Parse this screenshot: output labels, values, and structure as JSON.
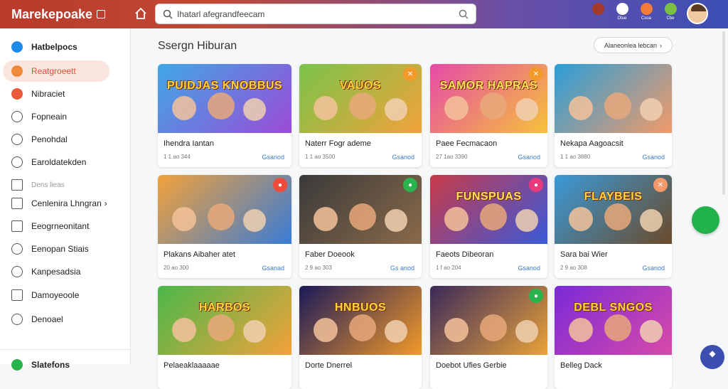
{
  "app": {
    "logo": "Marekepoake"
  },
  "search": {
    "value": "Ihatarl afegrandfeecam"
  },
  "topbar_icons": [
    {
      "name": "profile-badge-icon",
      "label": "",
      "color": "#a33a2a"
    },
    {
      "name": "calendar-icon",
      "label": "Otue",
      "color": "#ffffff"
    },
    {
      "name": "game-icon",
      "label": "Csoa",
      "color": "#f47a3a"
    },
    {
      "name": "chat-icon",
      "label": "Cbe",
      "color": "#7bc043"
    }
  ],
  "sidebar": {
    "items": [
      {
        "label": "Hatbelpocs",
        "icon": "compass-icon",
        "icon_color": "#1e8be6",
        "style": "bold"
      },
      {
        "label": "Reatgroeett",
        "icon": "fire-icon",
        "icon_color": "#f08a3a",
        "style": "active"
      },
      {
        "label": "Nibraciet",
        "icon": "star-icon",
        "icon_color": "#e85a3a",
        "style": ""
      },
      {
        "label": "Fopneain",
        "icon": "clock-icon",
        "icon_color": "",
        "style": "outline"
      },
      {
        "label": "Penohdal",
        "icon": "history-icon",
        "icon_color": "",
        "style": "outline"
      },
      {
        "label": "Earoldatekden",
        "icon": "bookmark-icon",
        "icon_color": "",
        "style": "outline"
      },
      {
        "label": "Dens lieas",
        "icon": "minus-icon",
        "icon_color": "",
        "style": "muted"
      },
      {
        "label": "Cenlenira Lhngran",
        "icon": "grid-icon",
        "icon_color": "",
        "style": "arrow"
      },
      {
        "label": "Eeogrneonitant",
        "icon": "list-icon",
        "icon_color": "",
        "style": "plain"
      },
      {
        "label": "Eenopan Stiais",
        "icon": "settings-icon",
        "icon_color": "",
        "style": "outline"
      },
      {
        "label": "Kanpesadsia",
        "icon": "support-icon",
        "icon_color": "",
        "style": "outline"
      },
      {
        "label": "Damoyeoole",
        "icon": "chart-icon",
        "icon_color": "",
        "style": "plain"
      },
      {
        "label": "Denoael",
        "icon": "info-icon",
        "icon_color": "",
        "style": "outline"
      }
    ],
    "footer_label": "Slatefons"
  },
  "main": {
    "title": "Ssergn Hiburan",
    "header_button": "Alaneonlea lebcan"
  },
  "cards": [
    {
      "title": "PUIDJAS KNOBBUS",
      "name": "Ihendra Iantan",
      "meta": "1 1 ao 344",
      "link": "Gsanod",
      "bg": [
        "#3fa8e6",
        "#9b4bd6"
      ],
      "title_color": "#ffd83a",
      "badge": "",
      "badge_color": ""
    },
    {
      "title": "VAUOS",
      "name": "Naterr Fogr ademe",
      "meta": "1 1 ao 3500",
      "link": "Gsanod",
      "bg": [
        "#79c44a",
        "#f2a23a"
      ],
      "title_color": "#ffd83a",
      "badge": "✕",
      "badge_color": "#f29a2a"
    },
    {
      "title": "SAMOR HAPRAS",
      "name": "Paee Fecmacaon",
      "meta": "27 1ao 3390",
      "link": "Gsanod",
      "bg": [
        "#e64aa8",
        "#f5c23a"
      ],
      "title_color": "#ffe45a",
      "badge": "✕",
      "badge_color": "#f29a2a"
    },
    {
      "title": "",
      "name": "Nekapa Aagoacsit",
      "meta": "1 1 ao 3880",
      "link": "Gsanod",
      "bg": [
        "#2a9fd8",
        "#f29a6a"
      ],
      "title_color": "#ffd83a",
      "badge": "",
      "badge_color": ""
    },
    {
      "title": "",
      "name": "Plakans Aibaher atet",
      "meta": "20 ao 300",
      "link": "Gsanad",
      "bg": [
        "#f2a23a",
        "#3a7bd5"
      ],
      "title_color": "#ffd83a",
      "badge": "●",
      "badge_color": "#f04a3a"
    },
    {
      "title": "",
      "name": "Faber Doeook",
      "meta": "2 9 ao 303",
      "link": "Gs anod",
      "bg": [
        "#3a3a3a",
        "#8a6a4a"
      ],
      "title_color": "#ffd83a",
      "badge": "●",
      "badge_color": "#2ab24c"
    },
    {
      "title": "FUNSPUAS",
      "name": "Faeots Dibeoran",
      "meta": "1 f ao 204",
      "link": "Gsanod",
      "bg": [
        "#c83a4a",
        "#3a5ad8"
      ],
      "title_color": "#ffe45a",
      "badge": "●",
      "badge_color": "#e83a7a"
    },
    {
      "title": "FLAYBEIS",
      "name": "Sara bai Wier",
      "meta": "2 9 ao 308",
      "link": "Gsanod",
      "bg": [
        "#3a9ad8",
        "#6a4a2a"
      ],
      "title_color": "#ffd83a",
      "badge": "✕",
      "badge_color": "#f29a6a"
    },
    {
      "title": "HARBOS",
      "name": "Pelaeaklaaaaae",
      "meta": "",
      "link": "",
      "bg": [
        "#4ab84a",
        "#f2a23a"
      ],
      "title_color": "#ffd83a",
      "badge": "",
      "badge_color": ""
    },
    {
      "title": "HNBUOS",
      "name": "Dorte Dnerrel",
      "meta": "",
      "link": "",
      "bg": [
        "#1a1a5a",
        "#f29a2a"
      ],
      "title_color": "#ffd83a",
      "badge": "",
      "badge_color": ""
    },
    {
      "title": "",
      "name": "Doebot Ufies Gerbie",
      "meta": "",
      "link": "",
      "bg": [
        "#3a2a5a",
        "#e8a23a"
      ],
      "title_color": "#ffd83a",
      "badge": "●",
      "badge_color": "#2ab24c"
    },
    {
      "title": "DEBL SNGOS",
      "name": "Belleg Dack",
      "meta": "",
      "link": "",
      "bg": [
        "#7a2ad8",
        "#d84aa8"
      ],
      "title_color": "#ffd83a",
      "badge": "",
      "badge_color": ""
    }
  ]
}
